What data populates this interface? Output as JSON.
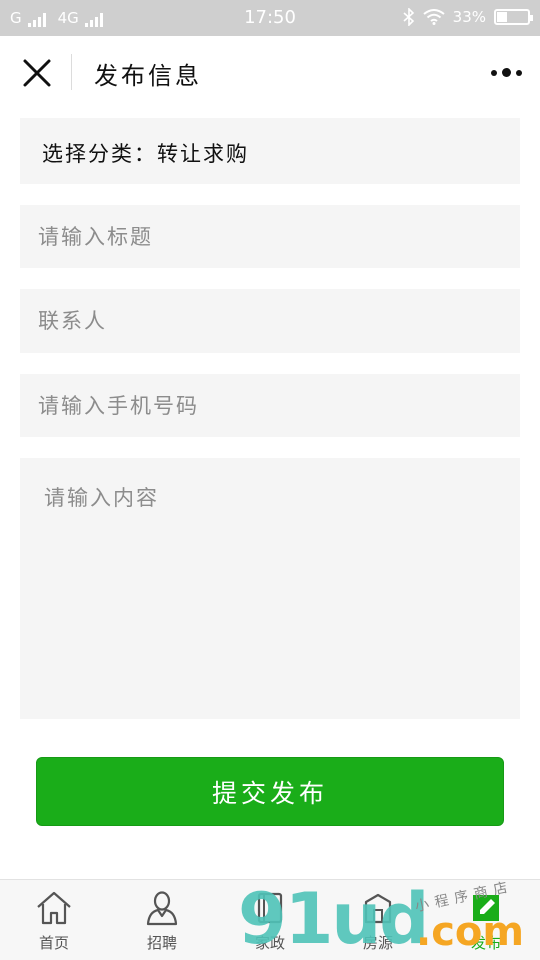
{
  "status_bar": {
    "carrier1": "G",
    "carrier2": "4G",
    "time": "17:50",
    "battery": "33%",
    "battery_level": 0.33
  },
  "nav": {
    "title": "发布信息"
  },
  "form": {
    "category_label": "选择分类：",
    "category_value": "转让求购",
    "title_placeholder": "请输入标题",
    "contact_placeholder": "联系人",
    "phone_placeholder": "请输入手机号码",
    "content_placeholder": "请输入内容",
    "submit_label": "提交发布"
  },
  "tabbar": {
    "items": [
      {
        "label": "首页",
        "icon": "home-icon"
      },
      {
        "label": "招聘",
        "icon": "user-icon"
      },
      {
        "label": "家政",
        "icon": "book-icon"
      },
      {
        "label": "房源",
        "icon": "building-icon"
      },
      {
        "label": "发布",
        "icon": "edit-icon"
      }
    ]
  },
  "watermark": {
    "main": "91ud",
    "sub": "小程序商店",
    "suffix": ".com"
  },
  "colors": {
    "accent": "#1aad19",
    "field_bg": "#f5f5f5",
    "status_bg": "#cfcfcf"
  }
}
